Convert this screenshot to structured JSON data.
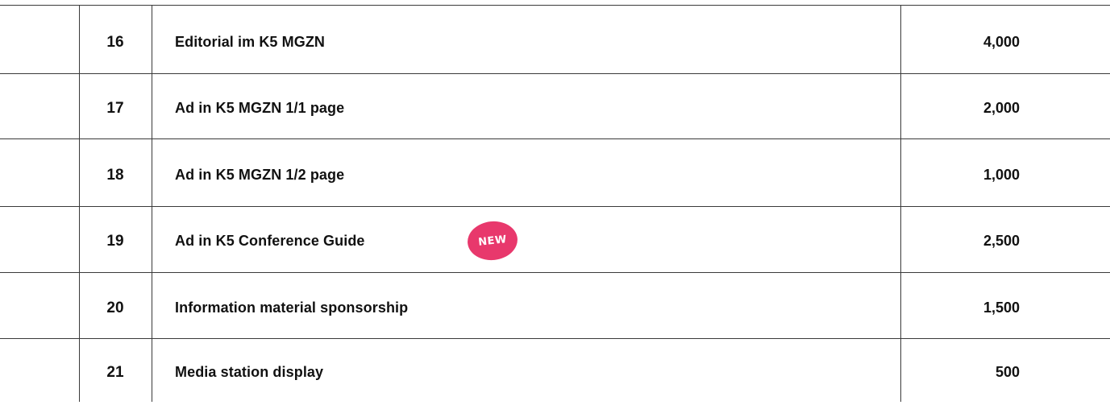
{
  "colors": {
    "border": "#3a3a3a",
    "text": "#111111",
    "badge_background": "#e8386c",
    "badge_text": "#ffffff"
  },
  "rows": [
    {
      "number": "16",
      "description": "Editorial im K5 MGZN",
      "price": "4,000"
    },
    {
      "number": "17",
      "description": "Ad in K5 MGZN 1/1 page",
      "price": "2,000"
    },
    {
      "number": "18",
      "description": "Ad in K5 MGZN 1/2 page",
      "price": "1,000"
    },
    {
      "number": "19",
      "description": "Ad in K5 Conference Guide",
      "price": "2,500",
      "badge": "NEW"
    },
    {
      "number": "20",
      "description": "Information material sponsorship",
      "price": "1,500"
    },
    {
      "number": "21",
      "description": "Media station display",
      "price": "500"
    }
  ]
}
